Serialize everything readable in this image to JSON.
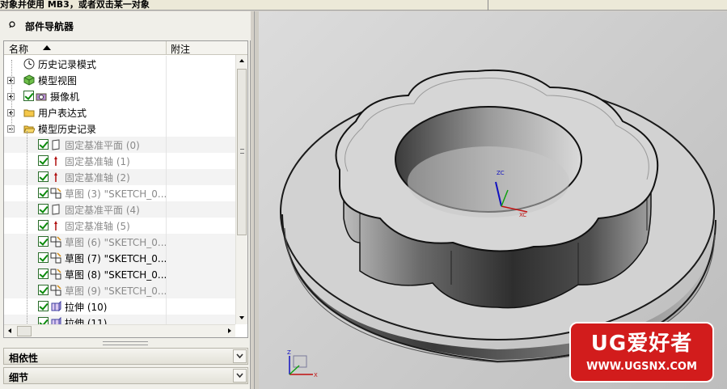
{
  "status_prompt": "对象并使用 MB3，或者双击某一对象",
  "navigator": {
    "title": "部件导航器",
    "columns": [
      "名称",
      "附注"
    ],
    "items": [
      {
        "label": "历史记录模式",
        "icon": "clock-icon",
        "level": 0,
        "expander": "none",
        "checked": false,
        "dim": false
      },
      {
        "label": "模型视图",
        "icon": "model-views-icon",
        "level": 0,
        "expander": "plus",
        "checked": false,
        "dim": false
      },
      {
        "label": "摄像机",
        "icon": "camera-icon",
        "level": 0,
        "expander": "plus",
        "checked": true,
        "dim": false
      },
      {
        "label": "用户表达式",
        "icon": "folder-icon",
        "level": 0,
        "expander": "plus",
        "checked": false,
        "dim": false
      },
      {
        "label": "模型历史记录",
        "icon": "folder-open-icon",
        "level": 0,
        "expander": "minus",
        "checked": false,
        "dim": false
      },
      {
        "label": "固定基准平面 (0)",
        "icon": "datum-plane-icon",
        "level": 1,
        "expander": "none",
        "checked": true,
        "dim": true
      },
      {
        "label": "固定基准轴 (1)",
        "icon": "datum-axis-icon",
        "level": 1,
        "expander": "none",
        "checked": true,
        "dim": true
      },
      {
        "label": "固定基准轴 (2)",
        "icon": "datum-axis-icon",
        "level": 1,
        "expander": "none",
        "checked": true,
        "dim": true
      },
      {
        "label": "草图 (3) \"SKETCH_0...",
        "icon": "sketch-icon",
        "level": 1,
        "expander": "none",
        "checked": true,
        "dim": true
      },
      {
        "label": "固定基准平面 (4)",
        "icon": "datum-plane-icon",
        "level": 1,
        "expander": "none",
        "checked": true,
        "dim": true
      },
      {
        "label": "固定基准轴 (5)",
        "icon": "datum-axis-icon",
        "level": 1,
        "expander": "none",
        "checked": true,
        "dim": true
      },
      {
        "label": "草图 (6) \"SKETCH_0...",
        "icon": "sketch-icon",
        "level": 1,
        "expander": "none",
        "checked": true,
        "dim": true
      },
      {
        "label": "草图 (7) \"SKETCH_0...",
        "icon": "sketch-icon",
        "level": 1,
        "expander": "none",
        "checked": true,
        "dim": false
      },
      {
        "label": "草图 (8) \"SKETCH_0...",
        "icon": "sketch-icon",
        "level": 1,
        "expander": "none",
        "checked": true,
        "dim": false
      },
      {
        "label": "草图 (9) \"SKETCH_0...",
        "icon": "sketch-icon",
        "level": 1,
        "expander": "none",
        "checked": true,
        "dim": true
      },
      {
        "label": "拉伸 (10)",
        "icon": "extrude-icon",
        "level": 1,
        "expander": "none",
        "checked": true,
        "dim": false
      },
      {
        "label": "拉伸 (11)",
        "icon": "extrude-icon",
        "level": 1,
        "expander": "none",
        "checked": true,
        "dim": false
      }
    ]
  },
  "sections": {
    "dependencies": "相依性",
    "details": "细节"
  },
  "viewport": {
    "wcs_labels": {
      "z": "ZC",
      "x": "XC"
    },
    "triad_labels": {
      "z": "Z",
      "x": "X"
    }
  },
  "watermark": {
    "title": "UG爱好者",
    "url": "WWW.UGSNX.COM"
  },
  "colors": {
    "panel_bg": "#f0efe9",
    "viewport_bg": "#cccccc",
    "watermark_red": "#d21c1c",
    "check_green": "#0a8a0a"
  }
}
